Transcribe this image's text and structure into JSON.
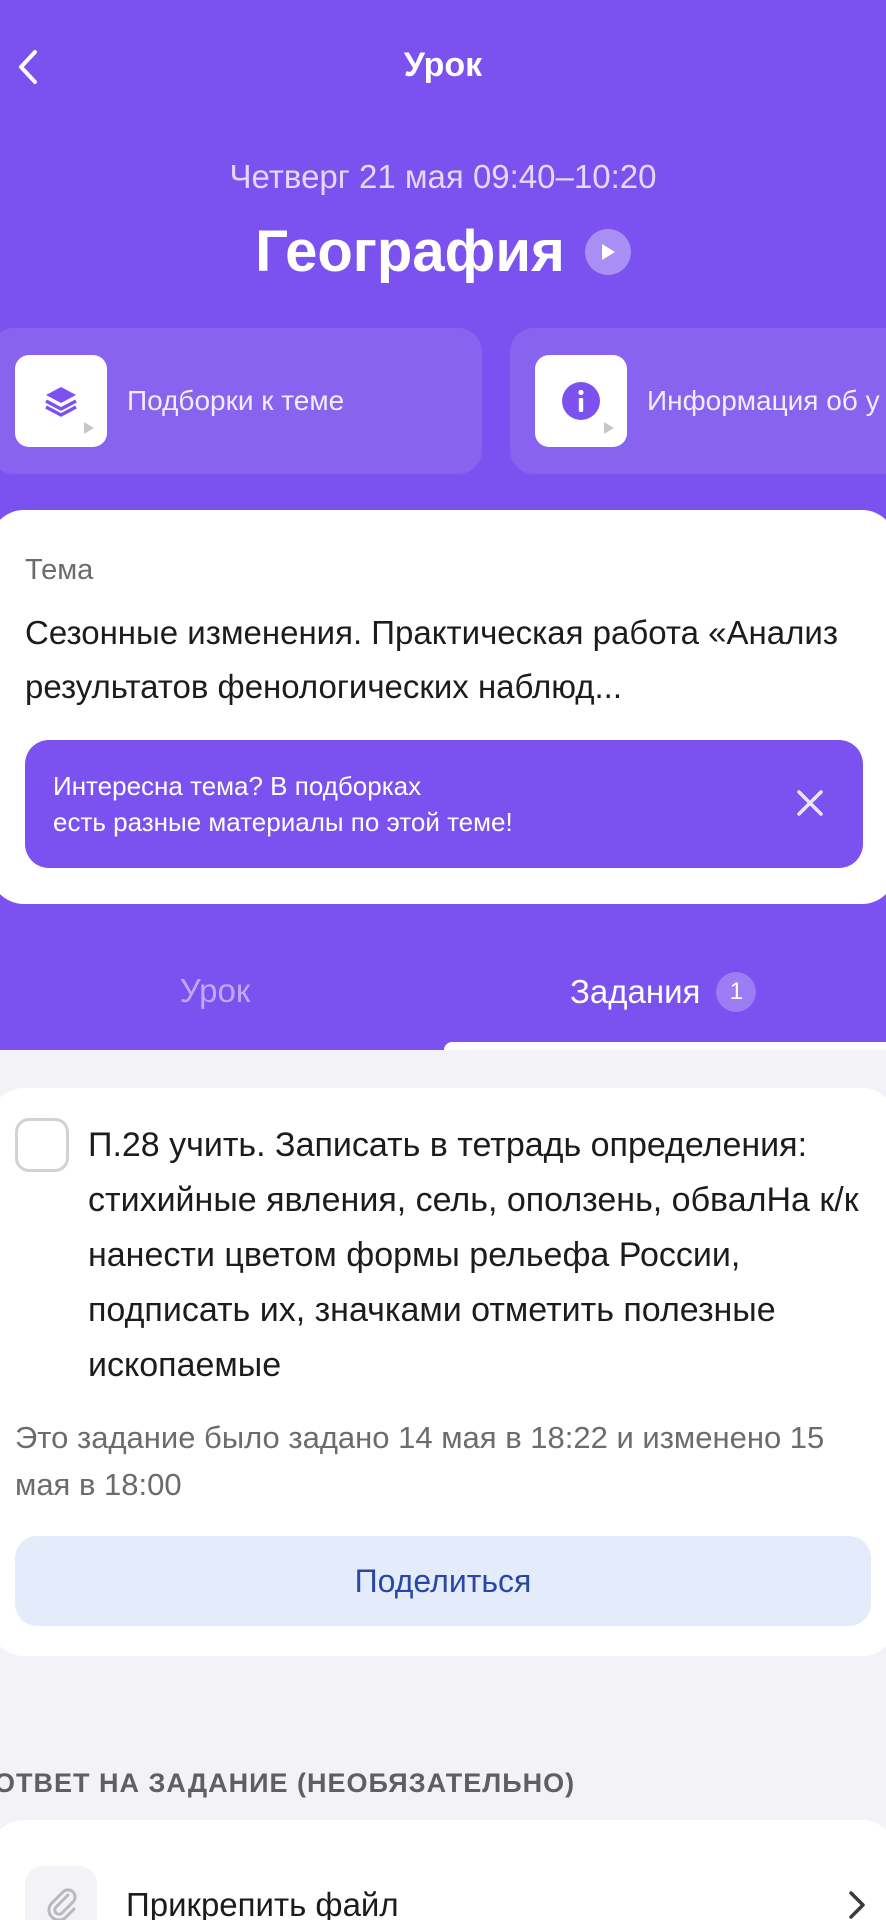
{
  "nav": {
    "title": "Урок"
  },
  "lesson": {
    "date_time": "Четверг 21 мая  09:40–10:20",
    "subject": "География"
  },
  "quick_cards": [
    {
      "label": "Подборки к теме",
      "icon": "layers-icon"
    },
    {
      "label": "Информация об у",
      "icon": "info-icon"
    }
  ],
  "topic": {
    "label": "Тема",
    "text": "Сезонные изменения. Практическая работа «Анализ результатов фенологических наблюд...",
    "hint": "Интересна тема? В подборках\nесть разные материалы по этой теме!"
  },
  "tabs": {
    "lesson": "Урок",
    "tasks": "Задания",
    "tasks_count": "1",
    "active": "tasks"
  },
  "task": {
    "text": "П.28 учить. Записать в тетрадь определения: стихийные явления, сель, оползень, обвалНа к/к нанести цветом формы рельефа России, подписать их, значками отметить полезные ископаемые",
    "meta": "Это задание было задано 14 мая в 18:22 и изменено 15 мая в 18:00",
    "share_label": "Поделиться",
    "checked": false
  },
  "answer": {
    "section_title": "ОТВЕТ НА ЗАДАНИЕ (НЕОБЯЗАТЕЛЬНО)",
    "attach_label": "Прикрепить файл"
  },
  "colors": {
    "accent": "#7B52EF",
    "share_bg": "#E4ECFB",
    "share_text": "#2847A8",
    "background": "#F2F2F7"
  }
}
